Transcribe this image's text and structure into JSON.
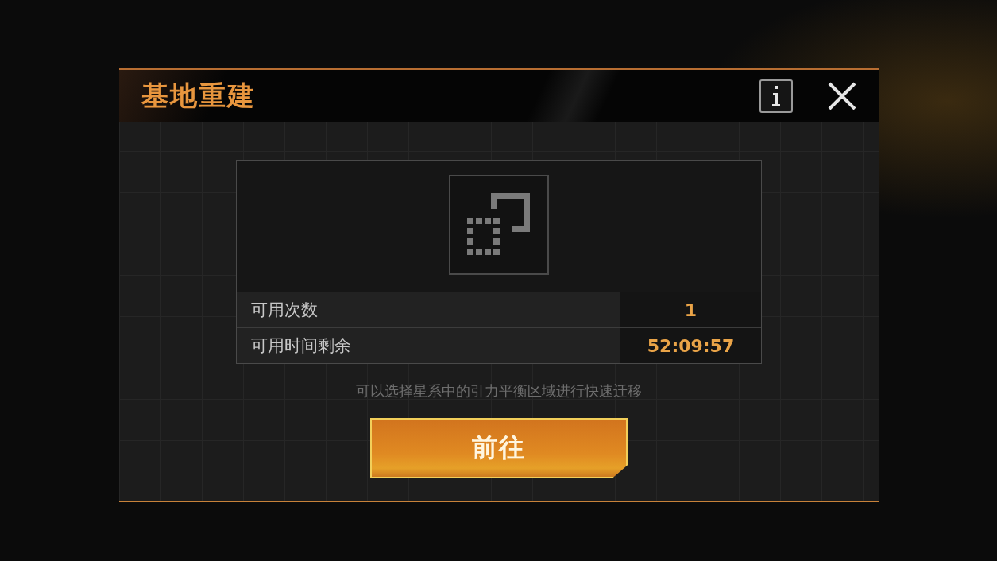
{
  "dialog": {
    "title": "基地重建"
  },
  "stats": [
    {
      "label": "可用次数",
      "value": "1"
    },
    {
      "label": "可用时间剩余",
      "value": "52:09:57"
    }
  ],
  "hint": "可以选择星系中的引力平衡区域进行快速迁移",
  "action": {
    "label": "前往"
  }
}
